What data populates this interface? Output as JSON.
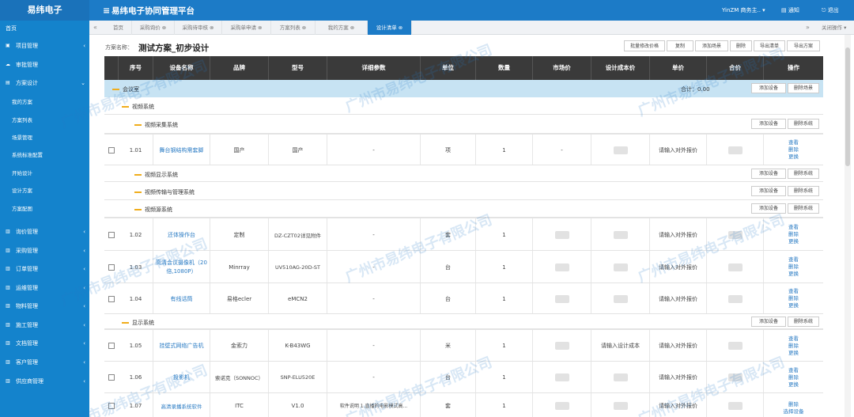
{
  "app": {
    "logo": "易纬电子",
    "menu_icon": "≡",
    "title": "易纬电子协同管理平台",
    "user": "YinZM 商务主.. ▾",
    "notice": "通知",
    "logout": "退出"
  },
  "sidebar": {
    "home": "首页",
    "items": [
      {
        "label": "项目管理",
        "icon": "home-icon"
      },
      {
        "label": "审批管理",
        "icon": "cloud-icon"
      },
      {
        "label": "方案设计",
        "icon": "file-icon"
      },
      {
        "label": "询价管理",
        "icon": "book-icon"
      },
      {
        "label": "采购管理",
        "icon": "cart-icon"
      },
      {
        "label": "订单管理",
        "icon": "list-icon"
      },
      {
        "label": "运维管理",
        "icon": "wrench-icon"
      },
      {
        "label": "物料管理",
        "icon": "box-icon"
      },
      {
        "label": "施工管理",
        "icon": "build-icon"
      },
      {
        "label": "文档管理",
        "icon": "doc-icon"
      },
      {
        "label": "客户管理",
        "icon": "user-icon"
      },
      {
        "label": "供应商管理",
        "icon": "truck-icon"
      }
    ],
    "sub_items": [
      "我的方案",
      "方案列表",
      "场景管理",
      "系统标准配置",
      "开始设计",
      "设计方案",
      "方案配图"
    ]
  },
  "tabs": {
    "items": [
      "首页",
      "采购询价 ⊗",
      "采购待审核 ⊗",
      "采购单申请 ⊗",
      "方案列表 ⊗",
      "我的方案 ⊗",
      "设计清单 ⊗"
    ],
    "close_ops": "关闭操作 ▾"
  },
  "plan": {
    "label": "方案名称：",
    "name": "测试方案_初步设计"
  },
  "toolbar": [
    "批量修改价格",
    "复制",
    "添加场景",
    "删除",
    "导出清单",
    "导出方案"
  ],
  "table": {
    "headers": [
      "序号",
      "设备名称",
      "品牌",
      "型号",
      "详细参数",
      "单位",
      "数量",
      "市场价",
      "设计成本价",
      "单价",
      "合价",
      "操作"
    ]
  },
  "scene": {
    "name": "会议室",
    "total": "合计：0.00",
    "add_device": "添加设备",
    "delete_scene": "删除场景"
  },
  "system_top": "视频系统",
  "sub_systems": [
    {
      "name": "视频采集系统"
    },
    {
      "name": "视频显示系统"
    },
    {
      "name": "视频传输与管理系统"
    },
    {
      "name": "视频源系统"
    }
  ],
  "display_system": "显示系统",
  "btn_add_device": "添加设备",
  "btn_delete_system": "删除系统",
  "rows": [
    {
      "idx": "1.01",
      "name": "舞台钢结构需套脚",
      "brand": "国产",
      "model": "国产",
      "params": "-",
      "unit": "项",
      "qty": "1",
      "market": "-",
      "cost": "",
      "price": "请输入对外报价",
      "ops": [
        "查看",
        "删除",
        "更换"
      ]
    },
    {
      "idx": "1.02",
      "name": "还体操作台",
      "brand": "定制",
      "model": "DZ-CZT02详见附件",
      "params": "-",
      "unit": "套",
      "qty": "1",
      "market": "",
      "cost": "",
      "price": "请输入对外报价",
      "ops": [
        "查看",
        "删除",
        "更换"
      ]
    },
    {
      "idx": "1.03",
      "name": "高清会议摄像机（20倍,1080P）",
      "brand": "Minrray",
      "model": "UV510AG-20D-ST",
      "params": "-",
      "unit": "台",
      "qty": "1",
      "market": "",
      "cost": "",
      "price": "请输入对外报价",
      "ops": [
        "查看",
        "删除",
        "更换"
      ]
    },
    {
      "idx": "1.04",
      "name": "有线话筒",
      "brand": "易格ecler",
      "model": "eMCN2",
      "params": "-",
      "unit": "台",
      "qty": "1",
      "market": "",
      "cost": "",
      "price": "请输入对外报价",
      "ops": [
        "查看",
        "删除",
        "更换"
      ]
    },
    {
      "idx": "1.05",
      "name": "挂壁式网络广告机",
      "brand": "金索力",
      "model": "K-B43WG",
      "params": "-",
      "unit": "米",
      "qty": "1",
      "market": "",
      "cost": "请输入设计成本",
      "price": "请输入对外报价",
      "ops": [
        "查看",
        "删除",
        "更换"
      ]
    },
    {
      "idx": "1.06",
      "name": "投影机",
      "brand": "索诺克（SONNOC）",
      "model": "SNP-ELU520E",
      "params": "-",
      "unit": "台",
      "qty": "1",
      "market": "",
      "cost": "",
      "price": "请输入对外报价",
      "ops": [
        "查看",
        "删除",
        "更换"
      ]
    },
    {
      "idx": "1.07",
      "name": "高清录播系统软件",
      "brand": "ITC",
      "model": "V1.0",
      "params": "软件说明 1.直播的电影模式高...",
      "unit": "套",
      "qty": "1",
      "market": "",
      "cost": "",
      "price": "请输入对外报价",
      "ops": [
        "删除",
        "选择设备"
      ]
    }
  ],
  "watermark": "广州市易纬电子有限公司"
}
